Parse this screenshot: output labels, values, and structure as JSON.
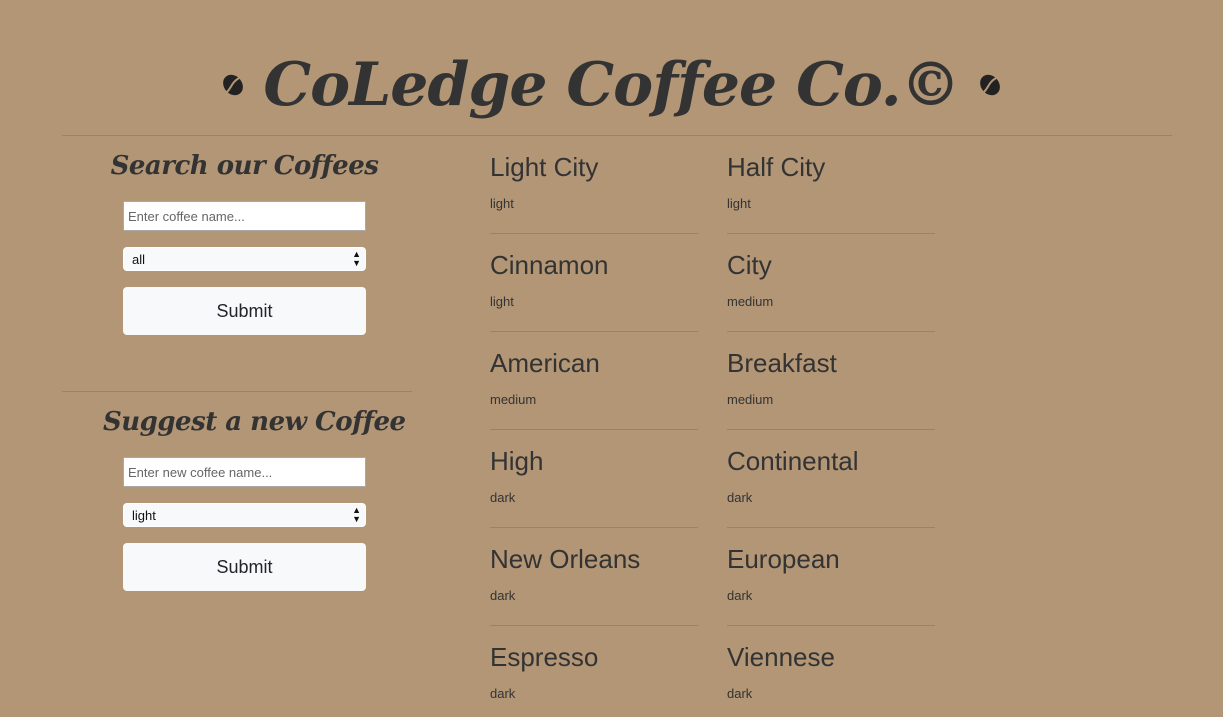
{
  "header": {
    "title": "CoLedge Coffee Co.©",
    "left_icon": "coffee-bean-icon",
    "right_icon": "coffee-bean-icon"
  },
  "search": {
    "title": "Search our Coffees",
    "input_placeholder": "Enter coffee name...",
    "input_value": "",
    "roast_selected": "all",
    "submit_label": "Submit"
  },
  "suggest": {
    "title": "Suggest a new Coffee",
    "input_placeholder": "Enter new coffee name...",
    "input_value": "",
    "roast_selected": "light",
    "submit_label": "Submit"
  },
  "coffees": {
    "left": [
      {
        "name": "Light City",
        "roast": "light"
      },
      {
        "name": "Cinnamon",
        "roast": "light"
      },
      {
        "name": "American",
        "roast": "medium"
      },
      {
        "name": "High",
        "roast": "dark"
      },
      {
        "name": "New Orleans",
        "roast": "dark"
      },
      {
        "name": "Espresso",
        "roast": "dark"
      }
    ],
    "right": [
      {
        "name": "Half City",
        "roast": "light"
      },
      {
        "name": "City",
        "roast": "medium"
      },
      {
        "name": "Breakfast",
        "roast": "medium"
      },
      {
        "name": "Continental",
        "roast": "dark"
      },
      {
        "name": "European",
        "roast": "dark"
      },
      {
        "name": "Viennese",
        "roast": "dark"
      }
    ]
  },
  "colors": {
    "background": "#b29676",
    "text": "#333333",
    "button": "#f8f9fa"
  }
}
